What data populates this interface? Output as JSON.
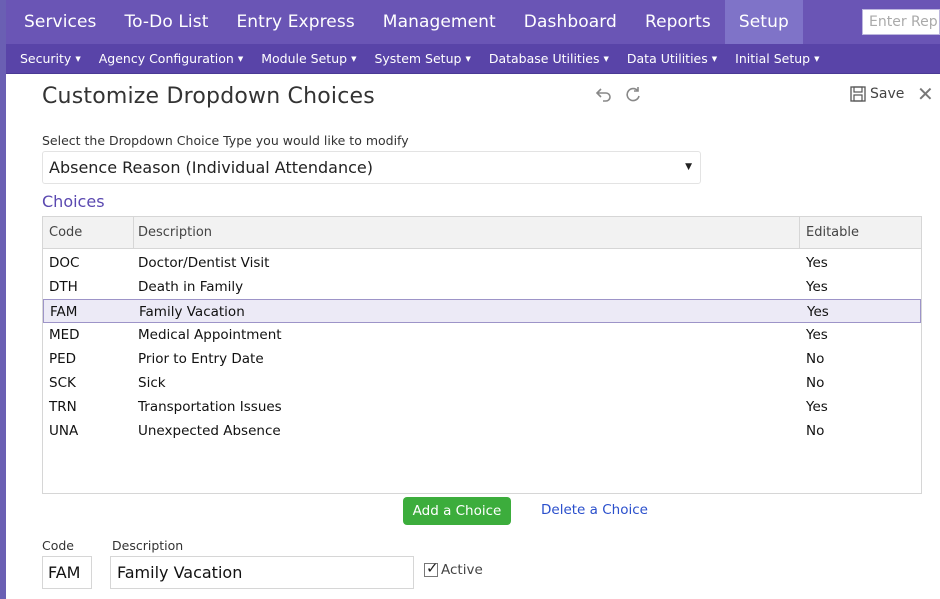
{
  "topnav": {
    "items": [
      "Services",
      "To-Do List",
      "Entry Express",
      "Management",
      "Dashboard",
      "Reports",
      "Setup"
    ],
    "active": "Setup",
    "search_placeholder": "Enter Rep"
  },
  "subnav": {
    "items": [
      "Security",
      "Agency Configuration",
      "Module Setup",
      "System Setup",
      "Database Utilities",
      "Data Utilities",
      "Initial Setup"
    ]
  },
  "page": {
    "title": "Customize Dropdown Choices",
    "save_label": "Save",
    "select_label": "Select the Dropdown Choice Type you would like to modify",
    "select_value": "Absence Reason (Individual Attendance)",
    "choices_title": "Choices"
  },
  "grid": {
    "headers": {
      "code": "Code",
      "description": "Description",
      "editable": "Editable"
    },
    "rows": [
      {
        "code": "DOC",
        "description": "Doctor/Dentist Visit",
        "editable": "Yes"
      },
      {
        "code": "DTH",
        "description": "Death in Family",
        "editable": "Yes"
      },
      {
        "code": "FAM",
        "description": "Family Vacation",
        "editable": "Yes"
      },
      {
        "code": "MED",
        "description": "Medical Appointment",
        "editable": "Yes"
      },
      {
        "code": "PED",
        "description": "Prior to Entry Date",
        "editable": "No"
      },
      {
        "code": "SCK",
        "description": "Sick",
        "editable": "No"
      },
      {
        "code": "TRN",
        "description": "Transportation Issues",
        "editable": "Yes"
      },
      {
        "code": "UNA",
        "description": "Unexpected Absence",
        "editable": "No"
      }
    ],
    "selected_index": 2
  },
  "actions": {
    "add_label": "Add a Choice",
    "delete_label": "Delete a Choice"
  },
  "form": {
    "code_label": "Code",
    "code_value": "FAM",
    "description_label": "Description",
    "description_value": "Family Vacation",
    "active_label": "Active",
    "active_checked": true
  },
  "icons": {
    "undo": "undo-icon",
    "refresh": "refresh-icon",
    "save": "floppy-disk-icon",
    "close": "close-icon"
  },
  "colors": {
    "nav": "#6a55b5",
    "subnav": "#5944a8",
    "add_button": "#3cad3c",
    "link": "#2a4fcc"
  }
}
